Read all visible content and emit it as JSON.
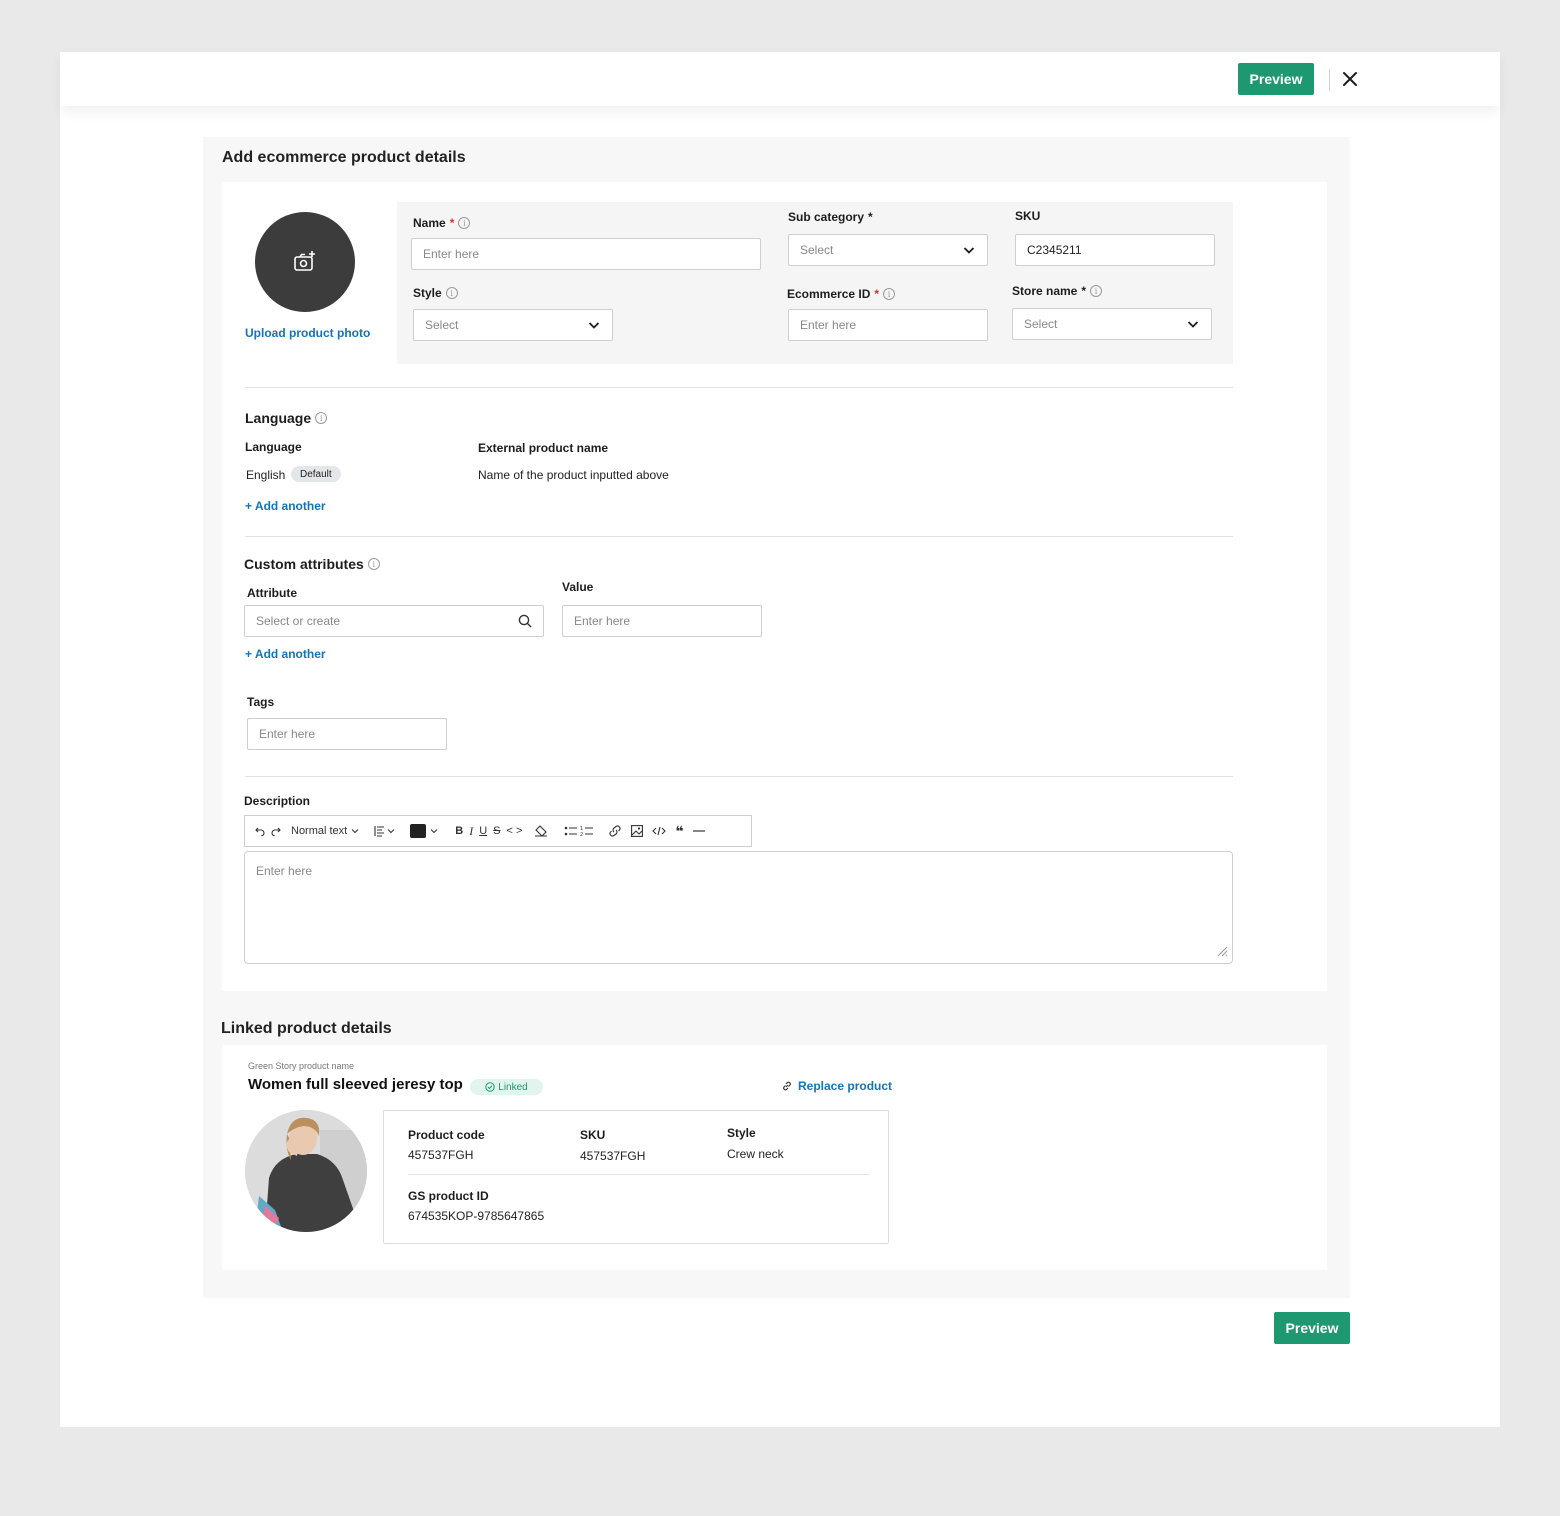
{
  "header": {
    "preview_label": "Preview"
  },
  "form": {
    "title": "Add ecommerce product details",
    "upload_label": "Upload product photo",
    "name": {
      "label": "Name",
      "placeholder": "Enter here"
    },
    "sub_category": {
      "label": "Sub category",
      "value": "Select"
    },
    "sku": {
      "label": "SKU",
      "value": "C2345211"
    },
    "style": {
      "label": "Style",
      "value": "Select"
    },
    "ecommerce_id": {
      "label": "Ecommerce ID",
      "placeholder": "Enter here"
    },
    "store_name": {
      "label": "Store name",
      "value": "Select"
    },
    "required_mark": "*"
  },
  "language": {
    "title": "Language",
    "col_language": "Language",
    "col_external": "External product name",
    "row_language": "English",
    "row_badge": "Default",
    "row_external": "Name of the product inputted above",
    "add_another": "+ Add another"
  },
  "custom_attributes": {
    "title": "Custom attributes",
    "attribute_label": "Attribute",
    "attribute_placeholder": "Select or create",
    "value_label": "Value",
    "value_placeholder": "Enter here",
    "add_another": "+ Add another"
  },
  "tags": {
    "label": "Tags",
    "placeholder": "Enter here"
  },
  "description": {
    "label": "Description",
    "text_style": "Normal text",
    "placeholder": "Enter here"
  },
  "linked": {
    "title": "Linked product details",
    "caption": "Green Story product name",
    "product_name": "Women full sleeved jeresy top",
    "status": "Linked",
    "replace_label": "Replace product",
    "product_code_label": "Product code",
    "product_code": "457537FGH",
    "sku_label": "SKU",
    "sku": "457537FGH",
    "style_label": "Style",
    "style": "Crew neck",
    "gs_id_label": "GS product ID",
    "gs_id": "674535KOP-9785647865"
  },
  "footer": {
    "preview_label": "Preview"
  },
  "colors": {
    "accent": "#1d9870",
    "link": "#1474b6",
    "required": "#d9302c",
    "avatar": "#3c3c3c"
  },
  "icons": [
    "close-icon",
    "camera-add-icon",
    "info-icon",
    "chevron-down-icon",
    "search-icon",
    "check-circle-icon",
    "link-icon"
  ]
}
